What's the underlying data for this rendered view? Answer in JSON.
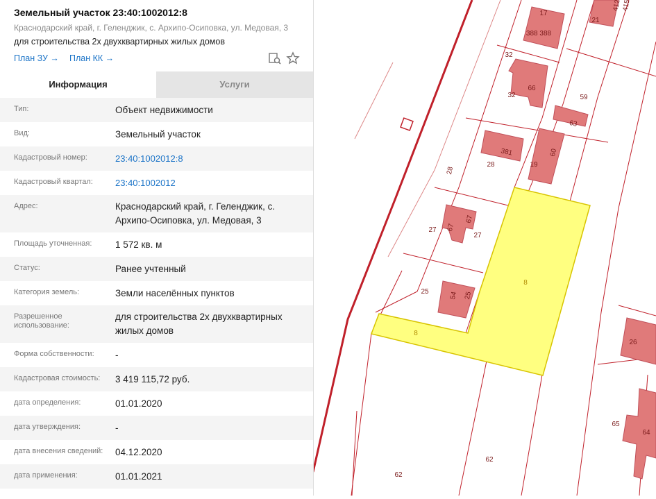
{
  "header": {
    "title": "Земельный участок 23:40:1002012:8",
    "address": "Краснодарский край, г. Геленджик, с. Архипо-Осиповка, ул. Медовая, 3",
    "purpose": "для строительства 2х двухквартирных жилых домов",
    "link_plan_zu": "План ЗУ →",
    "link_plan_kk": "План КК →",
    "icons": [
      "search-doc-icon",
      "star-icon"
    ]
  },
  "tabs": [
    {
      "label": "Информация",
      "active": true
    },
    {
      "label": "Услуги",
      "active": false
    }
  ],
  "info_rows": [
    {
      "label": "Тип:",
      "value": "Объект недвижимости"
    },
    {
      "label": "Вид:",
      "value": "Земельный участок"
    },
    {
      "label": "Кадастровый номер:",
      "value": "23:40:1002012:8"
    },
    {
      "label": "Кадастровый квартал:",
      "value": "23:40:1002012"
    },
    {
      "label": "Адрес:",
      "value": "Краснодарский край, г. Геленджик, с. Архипо-Осиповка, ул. Медовая, 3"
    },
    {
      "label": "Площадь уточненная:",
      "value": "1 572 кв. м"
    },
    {
      "label": "Статус:",
      "value": "Ранее учтенный"
    },
    {
      "label": "Категория земель:",
      "value": "Земли населённых пунктов"
    },
    {
      "label": "Разрешенное использование:",
      "value": "для строительства 2х двухквартирных жилых домов"
    },
    {
      "label": "Форма собственности:",
      "value": "-"
    },
    {
      "label": "Кадастровая стоимость:",
      "value": "3 419 115,72 руб."
    },
    {
      "label": "дата определения:",
      "value": "01.01.2020"
    },
    {
      "label": "дата утверждения:",
      "value": "-"
    },
    {
      "label": "дата внесения сведений:",
      "value": "04.12.2020"
    },
    {
      "label": "дата применения:",
      "value": "01.01.2021"
    }
  ],
  "map": {
    "colors": {
      "parcel_line": "#c0202a",
      "building_fill": "#e07a7a",
      "selected_fill": "#ffff80",
      "selected_stroke": "#d8c400"
    },
    "selected_parcel_label": "8",
    "selected_parcel_label_2": "8",
    "parcel_labels": [
      "17",
      "21",
      "32",
      "32",
      "59",
      "28",
      "28",
      "19",
      "27",
      "27",
      "25",
      "25",
      "26",
      "65",
      "62",
      "62"
    ],
    "building_labels": [
      "388 388",
      "66",
      "63",
      "381",
      "60",
      "67",
      "67",
      "54",
      "64"
    ],
    "partial_labels": [
      "412",
      "415"
    ]
  }
}
